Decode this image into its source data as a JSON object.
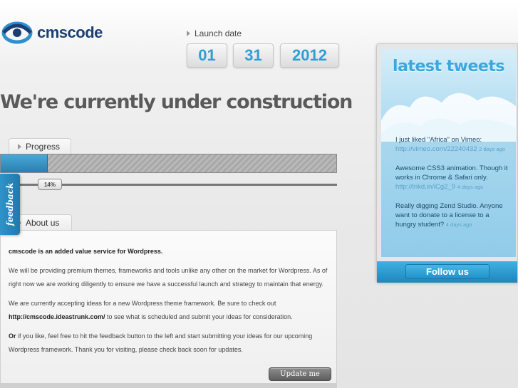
{
  "logo": {
    "name": "cmscode"
  },
  "launch": {
    "label": "Launch date",
    "month": "01",
    "day": "31",
    "year": "2012"
  },
  "headline": "We're currently under construction",
  "progress": {
    "tab_label": "Progress",
    "percent_text": "14%",
    "value": 0.14
  },
  "feedback": {
    "label": "feedback"
  },
  "about": {
    "tab_label": "About us",
    "intro": "cmscode is an added value service for Wordpress.",
    "p1": "We will be providing premium themes, frameworks and tools unlike any other on the market for Wordpress. As of right now we are working diligently to ensure we have a successful launch and strategy to maintain that energy.",
    "p2_before": "We are currently accepting ideas for a new Wordpress theme framework. Be sure to check out ",
    "p2_link": "http://cmscode.ideastrunk.com/",
    "p2_after": " to see what is scheduled and submit your ideas for consideration.",
    "p3_or": "Or",
    "p3_rest": " if you like, feel free to hit the feedback button to the left and start submitting your ideas for our upcoming Wordpress framework. Thank you for visiting, please check back soon for updates.",
    "update_button": "Update me"
  },
  "tweets": {
    "title": "latest tweets",
    "items": [
      {
        "text": "I just liked \"Africa\" on Vimeo: ",
        "link": "http://vimeo.com/22240432",
        "when": "2 days ago"
      },
      {
        "text": "Awesome CSS3 animation. Though it works in Chrome & Safari only. ",
        "link": "http://lnkd.in/iCg2_9",
        "when": "4 days ago"
      },
      {
        "text": "Really digging Zend Studio. Anyone want to donate to a license to a hungry student? ",
        "link": "",
        "when": "4 days ago"
      }
    ],
    "follow_button": "Follow us"
  },
  "colors": {
    "accent": "#2e9fd3",
    "brand": "#1c3f73"
  }
}
